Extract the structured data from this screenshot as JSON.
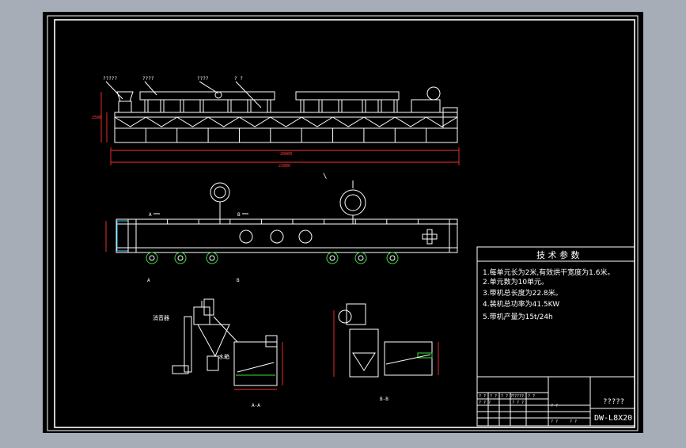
{
  "drawing": {
    "title_block_code": "DW-L8X20",
    "title_block_name": "?????",
    "tech_params": {
      "heading": "技 术 参 数",
      "lines": [
        "1.每单元长为2米,有效烘干宽度为1.6米。",
        "2.单元数为10单元。",
        "3.带机总长度为22.8米。",
        "4.装机总功率为41.5KW",
        "5.带机产量为15t/24h"
      ]
    },
    "section_labels": {
      "aa": "A-A",
      "bb": "B-B",
      "a_mark": "A",
      "b_mark": "B"
    },
    "callouts": [
      "?????",
      "????",
      "????",
      "?  ?"
    ],
    "side_labels": {
      "silencer": "消音器",
      "water_tank": "水箱"
    },
    "dims": {
      "total": "22800",
      "inner": "20000",
      "unit": "2000",
      "height": "2500"
    },
    "marks": {
      "tick": "\\"
    },
    "title_block_cells": [
      "? ?",
      "?  ?",
      "? ? ?",
      "?????",
      "? ?",
      "? ? ?",
      "? ? ?",
      "? ?",
      "? ?",
      "? ?"
    ]
  },
  "colors": {
    "background": "#000000",
    "frame": "#ffffff",
    "dimension": "#ff3030",
    "accent_green": "#40e040",
    "accent_cyan": "#40c8ff",
    "window_bg": "#a6adb7"
  }
}
